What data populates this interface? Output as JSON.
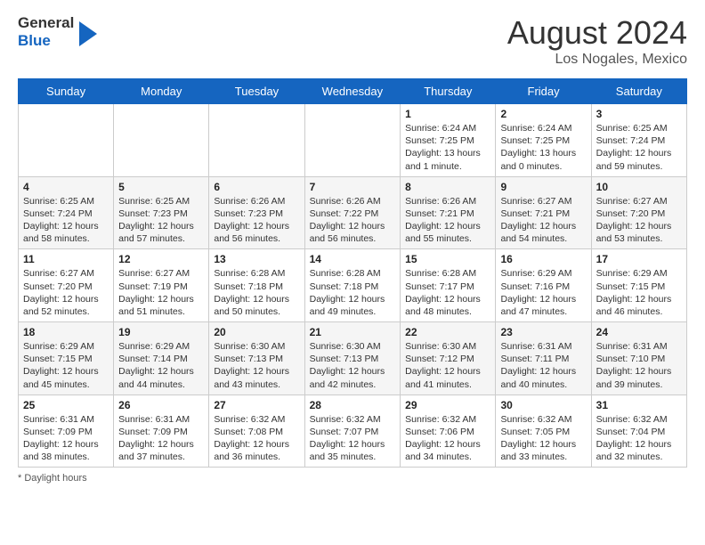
{
  "header": {
    "logo_line1": "General",
    "logo_line2": "Blue",
    "month_year": "August 2024",
    "location": "Los Nogales, Mexico"
  },
  "days_of_week": [
    "Sunday",
    "Monday",
    "Tuesday",
    "Wednesday",
    "Thursday",
    "Friday",
    "Saturday"
  ],
  "footer": {
    "daylight_label": "Daylight hours"
  },
  "weeks": [
    [
      {
        "day": "",
        "info": ""
      },
      {
        "day": "",
        "info": ""
      },
      {
        "day": "",
        "info": ""
      },
      {
        "day": "",
        "info": ""
      },
      {
        "day": "1",
        "info": "Sunrise: 6:24 AM\nSunset: 7:25 PM\nDaylight: 13 hours and 1 minute."
      },
      {
        "day": "2",
        "info": "Sunrise: 6:24 AM\nSunset: 7:25 PM\nDaylight: 13 hours and 0 minutes."
      },
      {
        "day": "3",
        "info": "Sunrise: 6:25 AM\nSunset: 7:24 PM\nDaylight: 12 hours and 59 minutes."
      }
    ],
    [
      {
        "day": "4",
        "info": "Sunrise: 6:25 AM\nSunset: 7:24 PM\nDaylight: 12 hours and 58 minutes."
      },
      {
        "day": "5",
        "info": "Sunrise: 6:25 AM\nSunset: 7:23 PM\nDaylight: 12 hours and 57 minutes."
      },
      {
        "day": "6",
        "info": "Sunrise: 6:26 AM\nSunset: 7:23 PM\nDaylight: 12 hours and 56 minutes."
      },
      {
        "day": "7",
        "info": "Sunrise: 6:26 AM\nSunset: 7:22 PM\nDaylight: 12 hours and 56 minutes."
      },
      {
        "day": "8",
        "info": "Sunrise: 6:26 AM\nSunset: 7:21 PM\nDaylight: 12 hours and 55 minutes."
      },
      {
        "day": "9",
        "info": "Sunrise: 6:27 AM\nSunset: 7:21 PM\nDaylight: 12 hours and 54 minutes."
      },
      {
        "day": "10",
        "info": "Sunrise: 6:27 AM\nSunset: 7:20 PM\nDaylight: 12 hours and 53 minutes."
      }
    ],
    [
      {
        "day": "11",
        "info": "Sunrise: 6:27 AM\nSunset: 7:20 PM\nDaylight: 12 hours and 52 minutes."
      },
      {
        "day": "12",
        "info": "Sunrise: 6:27 AM\nSunset: 7:19 PM\nDaylight: 12 hours and 51 minutes."
      },
      {
        "day": "13",
        "info": "Sunrise: 6:28 AM\nSunset: 7:18 PM\nDaylight: 12 hours and 50 minutes."
      },
      {
        "day": "14",
        "info": "Sunrise: 6:28 AM\nSunset: 7:18 PM\nDaylight: 12 hours and 49 minutes."
      },
      {
        "day": "15",
        "info": "Sunrise: 6:28 AM\nSunset: 7:17 PM\nDaylight: 12 hours and 48 minutes."
      },
      {
        "day": "16",
        "info": "Sunrise: 6:29 AM\nSunset: 7:16 PM\nDaylight: 12 hours and 47 minutes."
      },
      {
        "day": "17",
        "info": "Sunrise: 6:29 AM\nSunset: 7:15 PM\nDaylight: 12 hours and 46 minutes."
      }
    ],
    [
      {
        "day": "18",
        "info": "Sunrise: 6:29 AM\nSunset: 7:15 PM\nDaylight: 12 hours and 45 minutes."
      },
      {
        "day": "19",
        "info": "Sunrise: 6:29 AM\nSunset: 7:14 PM\nDaylight: 12 hours and 44 minutes."
      },
      {
        "day": "20",
        "info": "Sunrise: 6:30 AM\nSunset: 7:13 PM\nDaylight: 12 hours and 43 minutes."
      },
      {
        "day": "21",
        "info": "Sunrise: 6:30 AM\nSunset: 7:13 PM\nDaylight: 12 hours and 42 minutes."
      },
      {
        "day": "22",
        "info": "Sunrise: 6:30 AM\nSunset: 7:12 PM\nDaylight: 12 hours and 41 minutes."
      },
      {
        "day": "23",
        "info": "Sunrise: 6:31 AM\nSunset: 7:11 PM\nDaylight: 12 hours and 40 minutes."
      },
      {
        "day": "24",
        "info": "Sunrise: 6:31 AM\nSunset: 7:10 PM\nDaylight: 12 hours and 39 minutes."
      }
    ],
    [
      {
        "day": "25",
        "info": "Sunrise: 6:31 AM\nSunset: 7:09 PM\nDaylight: 12 hours and 38 minutes."
      },
      {
        "day": "26",
        "info": "Sunrise: 6:31 AM\nSunset: 7:09 PM\nDaylight: 12 hours and 37 minutes."
      },
      {
        "day": "27",
        "info": "Sunrise: 6:32 AM\nSunset: 7:08 PM\nDaylight: 12 hours and 36 minutes."
      },
      {
        "day": "28",
        "info": "Sunrise: 6:32 AM\nSunset: 7:07 PM\nDaylight: 12 hours and 35 minutes."
      },
      {
        "day": "29",
        "info": "Sunrise: 6:32 AM\nSunset: 7:06 PM\nDaylight: 12 hours and 34 minutes."
      },
      {
        "day": "30",
        "info": "Sunrise: 6:32 AM\nSunset: 7:05 PM\nDaylight: 12 hours and 33 minutes."
      },
      {
        "day": "31",
        "info": "Sunrise: 6:32 AM\nSunset: 7:04 PM\nDaylight: 12 hours and 32 minutes."
      }
    ]
  ]
}
